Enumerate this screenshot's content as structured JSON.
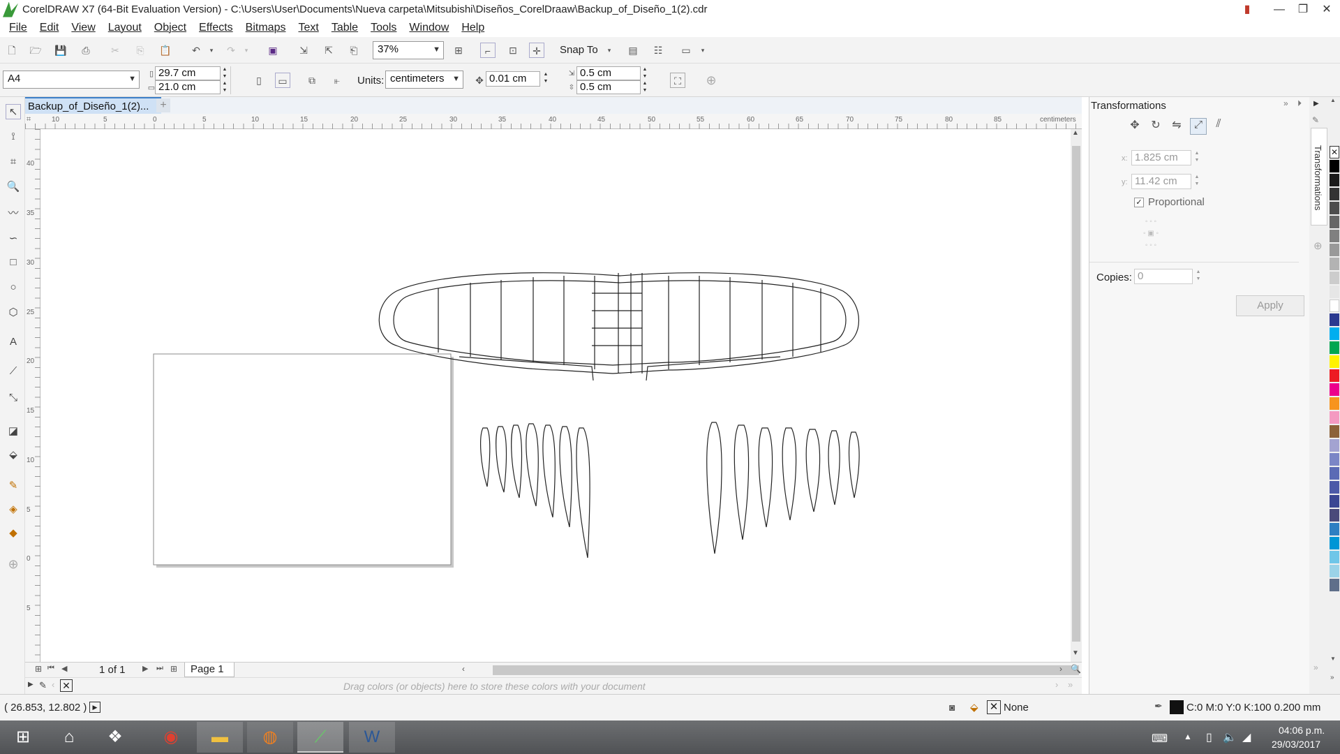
{
  "window": {
    "title": "CorelDRAW X7 (64-Bit Evaluation Version) - C:\\Users\\User\\Documents\\Nueva carpeta\\Mitsubishi\\Diseños_CorelDraaw\\Backup_of_Diseño_1(2).cdr"
  },
  "menu": [
    "File",
    "Edit",
    "View",
    "Layout",
    "Object",
    "Effects",
    "Bitmaps",
    "Text",
    "Table",
    "Tools",
    "Window",
    "Help"
  ],
  "toolbar": {
    "zoom": "37%",
    "snap_to": "Snap To"
  },
  "property_bar": {
    "page_size": "A4",
    "width": "29.7 cm",
    "height": "21.0 cm",
    "units_label": "Units:",
    "units": "centimeters",
    "nudge": "0.01 cm",
    "dup_x": "0.5 cm",
    "dup_y": "0.5 cm"
  },
  "document": {
    "tab": "Backup_of_Diseño_1(2)...",
    "ruler_unit": "centimeters"
  },
  "rulers": {
    "h_ticks": [
      "10",
      "5",
      "0",
      "5",
      "10",
      "15",
      "20",
      "25",
      "30",
      "35",
      "40",
      "45",
      "50",
      "55",
      "60",
      "65",
      "70",
      "75",
      "80",
      "85"
    ],
    "v_ticks": [
      "40",
      "35",
      "30",
      "25",
      "20",
      "15",
      "10",
      "5",
      "0",
      "5"
    ]
  },
  "page_nav": {
    "page_count": "1 of 1",
    "page_tab": "Page 1"
  },
  "color_tray": {
    "hint": "Drag colors (or objects) here to store these colors with your document"
  },
  "docker": {
    "title": "Transformations",
    "tab_label": "Transformations",
    "x_label": "x:",
    "x": "1.825 cm",
    "y_label": "y:",
    "y": "11.42 cm",
    "proportional": "Proportional",
    "copies_label": "Copies:",
    "copies": "0",
    "apply": "Apply"
  },
  "status": {
    "coords": "( 26.853, 12.802 )",
    "fill": "None",
    "outline": "C:0 M:0 Y:0 K:100  0.200 mm"
  },
  "taskbar": {
    "time": "04:06 p.m.",
    "date": "29/03/2017"
  },
  "palette_colors": [
    "#ffffff",
    "#000000",
    "#1a1a1a",
    "#333333",
    "#4d4d4d",
    "#666666",
    "#808080",
    "#999999",
    "#b3b3b3",
    "#cccccc",
    "#e6e6e6",
    "#ffffff",
    "#2b3990",
    "#00aeef",
    "#00a651",
    "#fff200",
    "#ed1c24",
    "#ec008c",
    "#f7941d",
    "#f49ac1",
    "#8c6239",
    "#a3a3d1",
    "#7b86c6",
    "#5b6bb5",
    "#4c5aa8",
    "#3a4693",
    "#4a4a7a",
    "#2e7fc2",
    "#0096d6",
    "#6fc6e8",
    "#9bd3e8",
    "#5f6f8a"
  ]
}
